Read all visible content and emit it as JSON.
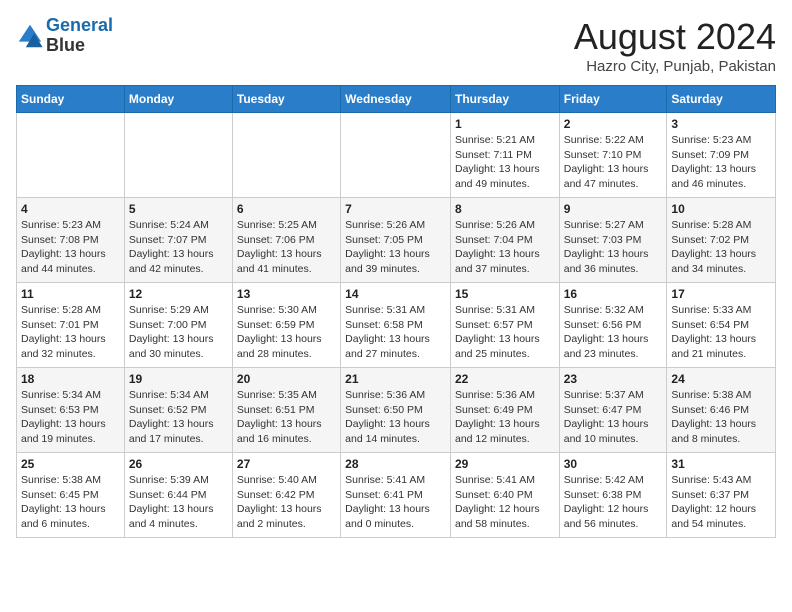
{
  "header": {
    "logo_line1": "General",
    "logo_line2": "Blue",
    "month": "August 2024",
    "location": "Hazro City, Punjab, Pakistan"
  },
  "weekdays": [
    "Sunday",
    "Monday",
    "Tuesday",
    "Wednesday",
    "Thursday",
    "Friday",
    "Saturday"
  ],
  "weeks": [
    [
      {
        "day": "",
        "info": ""
      },
      {
        "day": "",
        "info": ""
      },
      {
        "day": "",
        "info": ""
      },
      {
        "day": "",
        "info": ""
      },
      {
        "day": "1",
        "info": "Sunrise: 5:21 AM\nSunset: 7:11 PM\nDaylight: 13 hours\nand 49 minutes."
      },
      {
        "day": "2",
        "info": "Sunrise: 5:22 AM\nSunset: 7:10 PM\nDaylight: 13 hours\nand 47 minutes."
      },
      {
        "day": "3",
        "info": "Sunrise: 5:23 AM\nSunset: 7:09 PM\nDaylight: 13 hours\nand 46 minutes."
      }
    ],
    [
      {
        "day": "4",
        "info": "Sunrise: 5:23 AM\nSunset: 7:08 PM\nDaylight: 13 hours\nand 44 minutes."
      },
      {
        "day": "5",
        "info": "Sunrise: 5:24 AM\nSunset: 7:07 PM\nDaylight: 13 hours\nand 42 minutes."
      },
      {
        "day": "6",
        "info": "Sunrise: 5:25 AM\nSunset: 7:06 PM\nDaylight: 13 hours\nand 41 minutes."
      },
      {
        "day": "7",
        "info": "Sunrise: 5:26 AM\nSunset: 7:05 PM\nDaylight: 13 hours\nand 39 minutes."
      },
      {
        "day": "8",
        "info": "Sunrise: 5:26 AM\nSunset: 7:04 PM\nDaylight: 13 hours\nand 37 minutes."
      },
      {
        "day": "9",
        "info": "Sunrise: 5:27 AM\nSunset: 7:03 PM\nDaylight: 13 hours\nand 36 minutes."
      },
      {
        "day": "10",
        "info": "Sunrise: 5:28 AM\nSunset: 7:02 PM\nDaylight: 13 hours\nand 34 minutes."
      }
    ],
    [
      {
        "day": "11",
        "info": "Sunrise: 5:28 AM\nSunset: 7:01 PM\nDaylight: 13 hours\nand 32 minutes."
      },
      {
        "day": "12",
        "info": "Sunrise: 5:29 AM\nSunset: 7:00 PM\nDaylight: 13 hours\nand 30 minutes."
      },
      {
        "day": "13",
        "info": "Sunrise: 5:30 AM\nSunset: 6:59 PM\nDaylight: 13 hours\nand 28 minutes."
      },
      {
        "day": "14",
        "info": "Sunrise: 5:31 AM\nSunset: 6:58 PM\nDaylight: 13 hours\nand 27 minutes."
      },
      {
        "day": "15",
        "info": "Sunrise: 5:31 AM\nSunset: 6:57 PM\nDaylight: 13 hours\nand 25 minutes."
      },
      {
        "day": "16",
        "info": "Sunrise: 5:32 AM\nSunset: 6:56 PM\nDaylight: 13 hours\nand 23 minutes."
      },
      {
        "day": "17",
        "info": "Sunrise: 5:33 AM\nSunset: 6:54 PM\nDaylight: 13 hours\nand 21 minutes."
      }
    ],
    [
      {
        "day": "18",
        "info": "Sunrise: 5:34 AM\nSunset: 6:53 PM\nDaylight: 13 hours\nand 19 minutes."
      },
      {
        "day": "19",
        "info": "Sunrise: 5:34 AM\nSunset: 6:52 PM\nDaylight: 13 hours\nand 17 minutes."
      },
      {
        "day": "20",
        "info": "Sunrise: 5:35 AM\nSunset: 6:51 PM\nDaylight: 13 hours\nand 16 minutes."
      },
      {
        "day": "21",
        "info": "Sunrise: 5:36 AM\nSunset: 6:50 PM\nDaylight: 13 hours\nand 14 minutes."
      },
      {
        "day": "22",
        "info": "Sunrise: 5:36 AM\nSunset: 6:49 PM\nDaylight: 13 hours\nand 12 minutes."
      },
      {
        "day": "23",
        "info": "Sunrise: 5:37 AM\nSunset: 6:47 PM\nDaylight: 13 hours\nand 10 minutes."
      },
      {
        "day": "24",
        "info": "Sunrise: 5:38 AM\nSunset: 6:46 PM\nDaylight: 13 hours\nand 8 minutes."
      }
    ],
    [
      {
        "day": "25",
        "info": "Sunrise: 5:38 AM\nSunset: 6:45 PM\nDaylight: 13 hours\nand 6 minutes."
      },
      {
        "day": "26",
        "info": "Sunrise: 5:39 AM\nSunset: 6:44 PM\nDaylight: 13 hours\nand 4 minutes."
      },
      {
        "day": "27",
        "info": "Sunrise: 5:40 AM\nSunset: 6:42 PM\nDaylight: 13 hours\nand 2 minutes."
      },
      {
        "day": "28",
        "info": "Sunrise: 5:41 AM\nSunset: 6:41 PM\nDaylight: 13 hours\nand 0 minutes."
      },
      {
        "day": "29",
        "info": "Sunrise: 5:41 AM\nSunset: 6:40 PM\nDaylight: 12 hours\nand 58 minutes."
      },
      {
        "day": "30",
        "info": "Sunrise: 5:42 AM\nSunset: 6:38 PM\nDaylight: 12 hours\nand 56 minutes."
      },
      {
        "day": "31",
        "info": "Sunrise: 5:43 AM\nSunset: 6:37 PM\nDaylight: 12 hours\nand 54 minutes."
      }
    ]
  ]
}
